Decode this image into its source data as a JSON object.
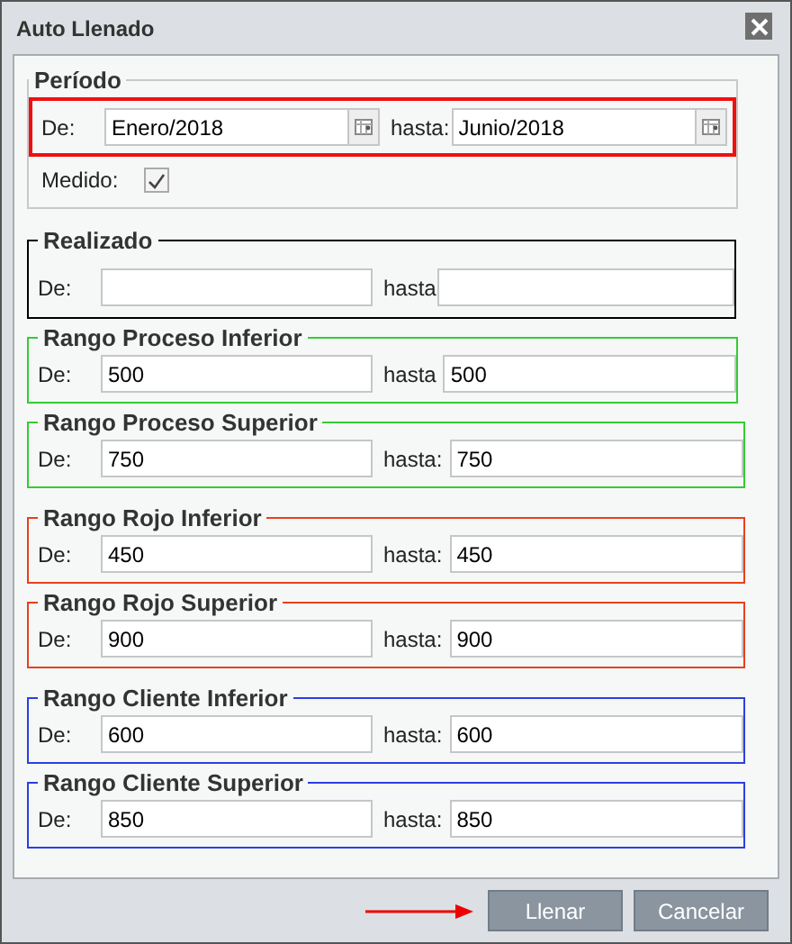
{
  "window": {
    "title": "Auto Llenado"
  },
  "periodo": {
    "title": "Período",
    "highlighted": true,
    "from_label": "De:",
    "from": "Enero/2018",
    "to_label": "hasta:",
    "to": "Junio/2018",
    "measured_label": "Medido:",
    "measured_checked": true
  },
  "realizado": {
    "title": "Realizado",
    "from_label": "De:",
    "to_label": "hasta"
  },
  "ranges": [
    {
      "title": "Rango Proceso Inferior",
      "color": "#33cc33",
      "from_label": "De:",
      "from": "500",
      "to_label": "hasta",
      "to": "500"
    },
    {
      "title": "Rango Proceso Superior",
      "color": "#33cc33",
      "from_label": "De:",
      "from": "750",
      "to_label": "hasta:",
      "to": "750"
    },
    {
      "title": "Rango Rojo Inferior",
      "color": "#e8401c",
      "from_label": "De:",
      "from": "450",
      "to_label": "hasta:",
      "to": "450"
    },
    {
      "title": "Rango Rojo Superior",
      "color": "#e8401c",
      "from_label": "De:",
      "from": "900",
      "to_label": "hasta:",
      "to": "900"
    },
    {
      "title": "Rango Cliente Inferior",
      "color": "#2b3fe0",
      "from_label": "De:",
      "from": "600",
      "to_label": "hasta:",
      "to": "600"
    },
    {
      "title": "Rango Cliente Superior",
      "color": "#2b3fe0",
      "from_label": "De:",
      "from": "850",
      "to_label": "hasta:",
      "to": "850"
    }
  ],
  "buttons": [
    {
      "label": "Llenar",
      "arrow": true
    },
    {
      "label": "Cancelar",
      "arrow": false
    }
  ]
}
